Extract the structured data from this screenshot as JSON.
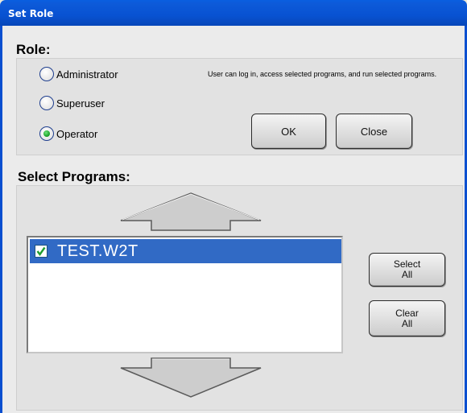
{
  "window": {
    "title": "Set Role"
  },
  "role": {
    "heading": "Role:",
    "options": [
      {
        "label": "Administrator",
        "selected": false
      },
      {
        "label": "Superuser",
        "selected": false
      },
      {
        "label": "Operator",
        "selected": true
      }
    ],
    "description": "User can log in, access selected programs, and run selected programs.",
    "ok_label": "OK",
    "close_label": "Close"
  },
  "programs": {
    "heading": "Select Programs:",
    "items": [
      {
        "label": "TEST.W2T",
        "checked": true,
        "selected": true
      }
    ],
    "select_all_line1": "Select",
    "select_all_line2": "All",
    "clear_all_line1": "Clear",
    "clear_all_line2": "All"
  },
  "colors": {
    "title_bar": "#0852d2",
    "selection": "#316ac5",
    "radio_selected": "#1fa52c",
    "checkmark": "#1f9d2e"
  }
}
